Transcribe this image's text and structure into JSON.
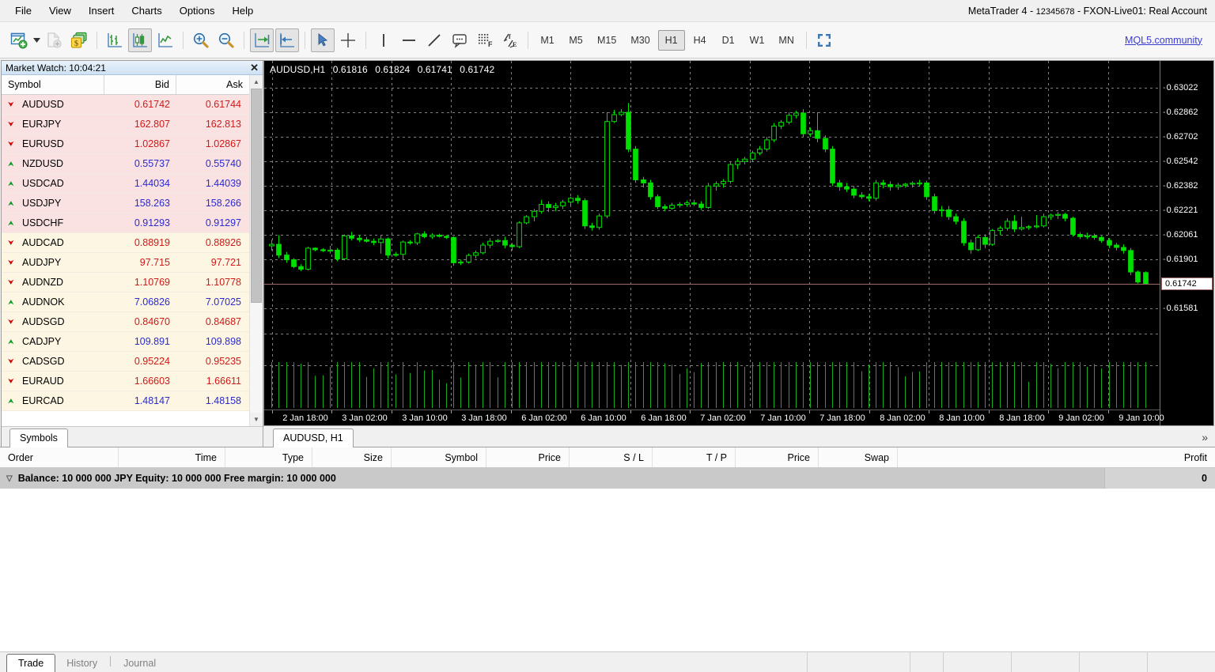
{
  "window": {
    "title": "MetaTrader 4 - 12345678 - FXON-Live01: Real Account",
    "title_prefix": "MetaTrader 4 - ",
    "account": "12345678",
    "title_suffix": " - FXON-Live01: Real Account"
  },
  "menu": {
    "items": [
      "File",
      "View",
      "Insert",
      "Charts",
      "Options",
      "Help"
    ]
  },
  "toolbar": {
    "buttons": [
      {
        "name": "new-chart-icon",
        "label": "New Chart",
        "state": "normal"
      },
      {
        "name": "new-order-icon",
        "label": "New Order",
        "state": "disabled"
      },
      {
        "name": "autotrading-icon",
        "label": "AutoTrading",
        "state": "normal"
      },
      {
        "name": "bar-chart-icon",
        "label": "Bar Chart",
        "state": "normal"
      },
      {
        "name": "candlestick-chart-icon",
        "label": "Candlesticks",
        "state": "active"
      },
      {
        "name": "line-chart-icon",
        "label": "Line Chart",
        "state": "normal"
      },
      {
        "name": "zoom-in-icon",
        "label": "Zoom In",
        "state": "normal"
      },
      {
        "name": "zoom-out-icon",
        "label": "Zoom Out",
        "state": "normal"
      },
      {
        "name": "auto-scroll-icon",
        "label": "Auto Scroll",
        "state": "active"
      },
      {
        "name": "chart-shift-icon",
        "label": "Chart Shift",
        "state": "active"
      },
      {
        "name": "cursor-icon",
        "label": "Cursor",
        "state": "active"
      },
      {
        "name": "crosshair-icon",
        "label": "Crosshair",
        "state": "normal"
      },
      {
        "name": "vertical-line-icon",
        "label": "Vertical Line",
        "state": "normal"
      },
      {
        "name": "horizontal-line-icon",
        "label": "Horizontal Line",
        "state": "normal"
      },
      {
        "name": "trendline-icon",
        "label": "Trendline",
        "state": "normal"
      },
      {
        "name": "text-label-icon",
        "label": "Text Label",
        "state": "normal"
      },
      {
        "name": "indicators-icon",
        "label": "Indicators",
        "state": "normal"
      },
      {
        "name": "expert-advisors-icon",
        "label": "Expert Advisors",
        "state": "normal"
      },
      {
        "name": "fullscreen-icon",
        "label": "Full Screen",
        "state": "normal"
      }
    ],
    "timeframes": [
      "M1",
      "M5",
      "M15",
      "M30",
      "H1",
      "H4",
      "D1",
      "W1",
      "MN"
    ],
    "active_timeframe": "H1",
    "mql_link": "MQL5.community"
  },
  "market_watch": {
    "title": "Market Watch: 10:04:21",
    "columns": [
      "Symbol",
      "Bid",
      "Ask"
    ],
    "tab": "Symbols",
    "rows": [
      {
        "symbol": "AUDUSD",
        "dir": "down",
        "bid": "0.61742",
        "ask": "0.61744",
        "color": "red",
        "tint": "pink"
      },
      {
        "symbol": "EURJPY",
        "dir": "down",
        "bid": "162.807",
        "ask": "162.813",
        "color": "red",
        "tint": "pink"
      },
      {
        "symbol": "EURUSD",
        "dir": "down",
        "bid": "1.02867",
        "ask": "1.02867",
        "color": "red",
        "tint": "pink"
      },
      {
        "symbol": "NZDUSD",
        "dir": "up",
        "bid": "0.55737",
        "ask": "0.55740",
        "color": "blue",
        "tint": "pink"
      },
      {
        "symbol": "USDCAD",
        "dir": "up",
        "bid": "1.44034",
        "ask": "1.44039",
        "color": "blue",
        "tint": "pink"
      },
      {
        "symbol": "USDJPY",
        "dir": "up",
        "bid": "158.263",
        "ask": "158.266",
        "color": "blue",
        "tint": "pink"
      },
      {
        "symbol": "USDCHF",
        "dir": "up",
        "bid": "0.91293",
        "ask": "0.91297",
        "color": "blue",
        "tint": "pink"
      },
      {
        "symbol": "AUDCAD",
        "dir": "down",
        "bid": "0.88919",
        "ask": "0.88926",
        "color": "red",
        "tint": "cream"
      },
      {
        "symbol": "AUDJPY",
        "dir": "down",
        "bid": "97.715",
        "ask": "97.721",
        "color": "red",
        "tint": "cream"
      },
      {
        "symbol": "AUDNZD",
        "dir": "down",
        "bid": "1.10769",
        "ask": "1.10778",
        "color": "red",
        "tint": "cream"
      },
      {
        "symbol": "AUDNOK",
        "dir": "up",
        "bid": "7.06826",
        "ask": "7.07025",
        "color": "blue",
        "tint": "cream"
      },
      {
        "symbol": "AUDSGD",
        "dir": "down",
        "bid": "0.84670",
        "ask": "0.84687",
        "color": "red",
        "tint": "cream"
      },
      {
        "symbol": "CADJPY",
        "dir": "up",
        "bid": "109.891",
        "ask": "109.898",
        "color": "blue",
        "tint": "cream"
      },
      {
        "symbol": "CADSGD",
        "dir": "down",
        "bid": "0.95224",
        "ask": "0.95235",
        "color": "red",
        "tint": "cream"
      },
      {
        "symbol": "EURAUD",
        "dir": "down",
        "bid": "1.66603",
        "ask": "1.66611",
        "color": "red",
        "tint": "cream"
      },
      {
        "symbol": "EURCAD",
        "dir": "up",
        "bid": "1.48147",
        "ask": "1.48158",
        "color": "blue",
        "tint": "cream"
      }
    ]
  },
  "chart": {
    "tab_label": "AUDUSD, H1",
    "header": {
      "symbol_tf": "AUDUSD,H1",
      "open": "0.61816",
      "high": "0.61824",
      "low": "0.61741",
      "close": "0.61742"
    },
    "current_price": "0.61742",
    "more_tabs_glyph": "»"
  },
  "chart_data": {
    "type": "candlestick",
    "title": "AUDUSD,H1",
    "symbol": "AUDUSD",
    "timeframe": "H1",
    "bullish_color": "#00e000",
    "background": "#000000",
    "grid": true,
    "ylim": [
      0.61501,
      0.63102
    ],
    "price_ticks": [
      "0.63022",
      "0.62862",
      "0.62702",
      "0.62542",
      "0.62382",
      "0.62221",
      "0.62061",
      "0.61901",
      "0.61742",
      "0.61581"
    ],
    "price_tick_values": [
      0.63022,
      0.62862,
      0.62702,
      0.62542,
      0.62382,
      0.62221,
      0.62061,
      0.61901,
      0.61742,
      0.61581
    ],
    "time_ticks": [
      "2 Jan 18:00",
      "3 Jan 02:00",
      "3 Jan 10:00",
      "3 Jan 18:00",
      "6 Jan 02:00",
      "6 Jan 10:00",
      "6 Jan 18:00",
      "7 Jan 02:00",
      "7 Jan 10:00",
      "7 Jan 18:00",
      "8 Jan 02:00",
      "8 Jan 10:00",
      "8 Jan 18:00",
      "9 Jan 02:00",
      "9 Jan 10:00"
    ],
    "bid_line": 0.61742,
    "last_ohlc": {
      "open": 0.61816,
      "high": 0.61824,
      "low": 0.61741,
      "close": 0.61742
    },
    "candles": [
      [
        0.6199,
        0.6203,
        0.6196,
        0.62
      ],
      [
        0.62,
        0.6206,
        0.6191,
        0.6193
      ],
      [
        0.6193,
        0.6195,
        0.6188,
        0.619
      ],
      [
        0.619,
        0.6191,
        0.61845,
        0.61855
      ],
      [
        0.61855,
        0.6187,
        0.61825,
        0.61838
      ],
      [
        0.61838,
        0.61985,
        0.6183,
        0.61975
      ],
      [
        0.61975,
        0.6198,
        0.61955,
        0.61965
      ],
      [
        0.61965,
        0.61975,
        0.6195,
        0.6196
      ],
      [
        0.6196,
        0.6199,
        0.6194,
        0.61962
      ],
      [
        0.61962,
        0.61975,
        0.6189,
        0.61905
      ],
      [
        0.61905,
        0.62065,
        0.61895,
        0.62055
      ],
      [
        0.62055,
        0.6208,
        0.62025,
        0.6204
      ],
      [
        0.6204,
        0.6206,
        0.62015,
        0.6203
      ],
      [
        0.6203,
        0.62048,
        0.62012,
        0.6202
      ],
      [
        0.6202,
        0.62038,
        0.61995,
        0.62012
      ],
      [
        0.62012,
        0.6206,
        0.6194,
        0.62035
      ],
      [
        0.62035,
        0.62045,
        0.6191,
        0.6193
      ],
      [
        0.6193,
        0.6195,
        0.6192,
        0.61935
      ],
      [
        0.61935,
        0.62025,
        0.619,
        0.62015
      ],
      [
        0.62015,
        0.62028,
        0.61998,
        0.6201
      ],
      [
        0.6201,
        0.62075,
        0.61995,
        0.62068
      ],
      [
        0.62068,
        0.62085,
        0.6204,
        0.6205
      ],
      [
        0.6205,
        0.62072,
        0.62035,
        0.6206
      ],
      [
        0.6206,
        0.6207,
        0.62045,
        0.62052
      ],
      [
        0.62052,
        0.6206,
        0.62035,
        0.62045
      ],
      [
        0.62045,
        0.62052,
        0.6186,
        0.6188
      ],
      [
        0.6188,
        0.619,
        0.61865,
        0.61885
      ],
      [
        0.61885,
        0.6194,
        0.61875,
        0.61928
      ],
      [
        0.61928,
        0.6196,
        0.61908,
        0.61945
      ],
      [
        0.61945,
        0.6201,
        0.61935,
        0.61995
      ],
      [
        0.61995,
        0.6204,
        0.61975,
        0.6202
      ],
      [
        0.6202,
        0.62035,
        0.6201,
        0.62025
      ],
      [
        0.62025,
        0.6205,
        0.61975,
        0.61995
      ],
      [
        0.61995,
        0.6201,
        0.6196,
        0.61985
      ],
      [
        0.61985,
        0.6215,
        0.61975,
        0.6214
      ],
      [
        0.6214,
        0.6219,
        0.6213,
        0.6218
      ],
      [
        0.6218,
        0.6223,
        0.6215,
        0.62215
      ],
      [
        0.62215,
        0.6229,
        0.622,
        0.6226
      ],
      [
        0.6226,
        0.6228,
        0.6221,
        0.6224
      ],
      [
        0.6224,
        0.6227,
        0.62215,
        0.6225
      ],
      [
        0.6225,
        0.6229,
        0.6223,
        0.62275
      ],
      [
        0.62275,
        0.6231,
        0.6225,
        0.623
      ],
      [
        0.623,
        0.6232,
        0.62265,
        0.62285
      ],
      [
        0.62285,
        0.623,
        0.621,
        0.6212
      ],
      [
        0.6212,
        0.6214,
        0.6209,
        0.6211
      ],
      [
        0.6211,
        0.622,
        0.62095,
        0.62185
      ],
      [
        0.62185,
        0.6286,
        0.6217,
        0.628
      ],
      [
        0.628,
        0.62875,
        0.6279,
        0.62845
      ],
      [
        0.62845,
        0.6288,
        0.62835,
        0.6286
      ],
      [
        0.6286,
        0.6292,
        0.626,
        0.6262
      ],
      [
        0.6262,
        0.6264,
        0.624,
        0.6242
      ],
      [
        0.6242,
        0.6244,
        0.6237,
        0.624
      ],
      [
        0.624,
        0.6242,
        0.6229,
        0.6231
      ],
      [
        0.6231,
        0.62325,
        0.6223,
        0.62245
      ],
      [
        0.62245,
        0.6226,
        0.62215,
        0.62235
      ],
      [
        0.62235,
        0.6227,
        0.62225,
        0.62255
      ],
      [
        0.62255,
        0.62275,
        0.6224,
        0.6226
      ],
      [
        0.6226,
        0.62285,
        0.62245,
        0.6227
      ],
      [
        0.6227,
        0.6229,
        0.6225,
        0.62262
      ],
      [
        0.62262,
        0.6228,
        0.62225,
        0.6224
      ],
      [
        0.6224,
        0.624,
        0.6223,
        0.6238
      ],
      [
        0.6238,
        0.6241,
        0.6235,
        0.62395
      ],
      [
        0.62395,
        0.62425,
        0.6237,
        0.6241
      ],
      [
        0.6241,
        0.6254,
        0.62395,
        0.6252
      ],
      [
        0.6252,
        0.6256,
        0.6249,
        0.6254
      ],
      [
        0.6254,
        0.6257,
        0.6252,
        0.62555
      ],
      [
        0.62555,
        0.6261,
        0.6254,
        0.62595
      ],
      [
        0.62595,
        0.6264,
        0.6258,
        0.6262
      ],
      [
        0.6262,
        0.627,
        0.62605,
        0.6268
      ],
      [
        0.6268,
        0.6279,
        0.62665,
        0.6277
      ],
      [
        0.6277,
        0.6281,
        0.6275,
        0.62795
      ],
      [
        0.62795,
        0.6286,
        0.6278,
        0.6284
      ],
      [
        0.6284,
        0.6287,
        0.6282,
        0.62855
      ],
      [
        0.62855,
        0.6288,
        0.627,
        0.6272
      ],
      [
        0.6272,
        0.6276,
        0.627,
        0.6274
      ],
      [
        0.6274,
        0.6286,
        0.62665,
        0.6269
      ],
      [
        0.6269,
        0.6271,
        0.626,
        0.6262
      ],
      [
        0.6262,
        0.6264,
        0.6238,
        0.624
      ],
      [
        0.624,
        0.6242,
        0.6235,
        0.62375
      ],
      [
        0.62375,
        0.624,
        0.6234,
        0.6236
      ],
      [
        0.6236,
        0.6238,
        0.623,
        0.6232
      ],
      [
        0.6232,
        0.6234,
        0.62295,
        0.6231
      ],
      [
        0.6231,
        0.6233,
        0.6228,
        0.623
      ],
      [
        0.623,
        0.6242,
        0.62285,
        0.624
      ],
      [
        0.624,
        0.6242,
        0.62365,
        0.6239
      ],
      [
        0.6239,
        0.6241,
        0.6235,
        0.62375
      ],
      [
        0.62375,
        0.624,
        0.62355,
        0.62385
      ],
      [
        0.62385,
        0.624,
        0.6237,
        0.62392
      ],
      [
        0.62392,
        0.6241,
        0.6237,
        0.62398
      ],
      [
        0.62398,
        0.6242,
        0.6238,
        0.624
      ],
      [
        0.624,
        0.62415,
        0.6229,
        0.6231
      ],
      [
        0.6231,
        0.6233,
        0.622,
        0.6222
      ],
      [
        0.6222,
        0.6225,
        0.6218,
        0.62225
      ],
      [
        0.62225,
        0.6225,
        0.6216,
        0.6218
      ],
      [
        0.6218,
        0.622,
        0.6213,
        0.6215
      ],
      [
        0.6215,
        0.6217,
        0.6199,
        0.6201
      ],
      [
        0.6201,
        0.6203,
        0.6194,
        0.61965
      ],
      [
        0.61965,
        0.6206,
        0.61955,
        0.62045
      ],
      [
        0.62045,
        0.62065,
        0.61975,
        0.62
      ],
      [
        0.62,
        0.621,
        0.6199,
        0.6209
      ],
      [
        0.6209,
        0.6212,
        0.6206,
        0.62105
      ],
      [
        0.62105,
        0.6217,
        0.6209,
        0.6215
      ],
      [
        0.6215,
        0.6219,
        0.6208,
        0.621
      ],
      [
        0.621,
        0.6218,
        0.6209,
        0.6211
      ],
      [
        0.6211,
        0.62125,
        0.62095,
        0.62115
      ],
      [
        0.62115,
        0.6219,
        0.62105,
        0.6212
      ],
      [
        0.6212,
        0.622,
        0.6211,
        0.6218
      ],
      [
        0.6218,
        0.622,
        0.6216,
        0.6219
      ],
      [
        0.6219,
        0.6221,
        0.62165,
        0.62195
      ],
      [
        0.62195,
        0.62205,
        0.6215,
        0.6217
      ],
      [
        0.6217,
        0.6218,
        0.6205,
        0.62065
      ],
      [
        0.62065,
        0.6208,
        0.62035,
        0.6205
      ],
      [
        0.6205,
        0.62075,
        0.62035,
        0.62055
      ],
      [
        0.62055,
        0.6207,
        0.6203,
        0.62045
      ],
      [
        0.62045,
        0.62055,
        0.6201,
        0.62025
      ],
      [
        0.62025,
        0.6204,
        0.61975,
        0.61995
      ],
      [
        0.61995,
        0.6201,
        0.6196,
        0.6198
      ],
      [
        0.6198,
        0.62,
        0.6194,
        0.6196
      ],
      [
        0.6196,
        0.61975,
        0.618,
        0.6182
      ],
      [
        0.6182,
        0.6183,
        0.61745,
        0.61755
      ],
      [
        0.61816,
        0.61824,
        0.61741,
        0.61742
      ]
    ]
  },
  "terminal": {
    "columns": [
      "Order",
      "Time",
      "Type",
      "Size",
      "Symbol",
      "Price",
      "S / L",
      "T / P",
      "Price",
      "Swap",
      "Profit"
    ],
    "balance_line": "Balance: 10 000 000 JPY  Equity: 10 000 000  Free margin: 10 000 000",
    "profit_value": "0",
    "tabs": [
      "Trade",
      "History",
      "Journal"
    ],
    "active_tab": "Trade"
  }
}
